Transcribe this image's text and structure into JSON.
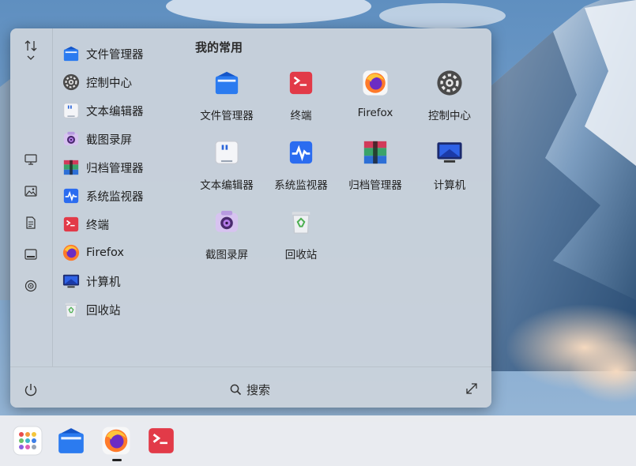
{
  "start_menu": {
    "favorites_title": "我的常用",
    "apps": [
      {
        "label": "文件管理器",
        "icon": "file-manager-icon"
      },
      {
        "label": "控制中心",
        "icon": "control-center-icon"
      },
      {
        "label": "文本编辑器",
        "icon": "text-editor-icon"
      },
      {
        "label": "截图录屏",
        "icon": "screenshot-icon"
      },
      {
        "label": "归档管理器",
        "icon": "archive-manager-icon"
      },
      {
        "label": "系统监视器",
        "icon": "system-monitor-icon"
      },
      {
        "label": "终端",
        "icon": "terminal-icon"
      },
      {
        "label": "Firefox",
        "icon": "firefox-icon"
      },
      {
        "label": "计算机",
        "icon": "computer-icon"
      },
      {
        "label": "回收站",
        "icon": "trash-icon"
      }
    ],
    "favorites": [
      {
        "label": "文件管理器",
        "icon": "file-manager-icon"
      },
      {
        "label": "终端",
        "icon": "terminal-icon"
      },
      {
        "label": "Firefox",
        "icon": "firefox-icon"
      },
      {
        "label": "控制中心",
        "icon": "control-center-icon"
      },
      {
        "label": "文本编辑器",
        "icon": "text-editor-icon"
      },
      {
        "label": "系统监视器",
        "icon": "system-monitor-icon"
      },
      {
        "label": "归档管理器",
        "icon": "archive-manager-icon"
      },
      {
        "label": "计算机",
        "icon": "computer-icon"
      },
      {
        "label": "截图录屏",
        "icon": "screenshot-icon"
      },
      {
        "label": "回收站",
        "icon": "trash-icon"
      }
    ],
    "search_label": "搜索",
    "sidebar_icons": [
      "sort-icon",
      "desktop-icon",
      "image-icon",
      "document-icon",
      "video-icon",
      "music-icon"
    ]
  },
  "taskbar": {
    "items": [
      {
        "icon": "launcher-icon"
      },
      {
        "icon": "file-manager-icon"
      },
      {
        "icon": "firefox-icon",
        "active": true
      },
      {
        "icon": "terminal-icon"
      }
    ]
  },
  "colors": {
    "accent_blue": "#1f6fe8",
    "terminal_red": "#e23a48",
    "menu_bg": "#cbd2db",
    "taskbar_bg": "#eceef0"
  }
}
